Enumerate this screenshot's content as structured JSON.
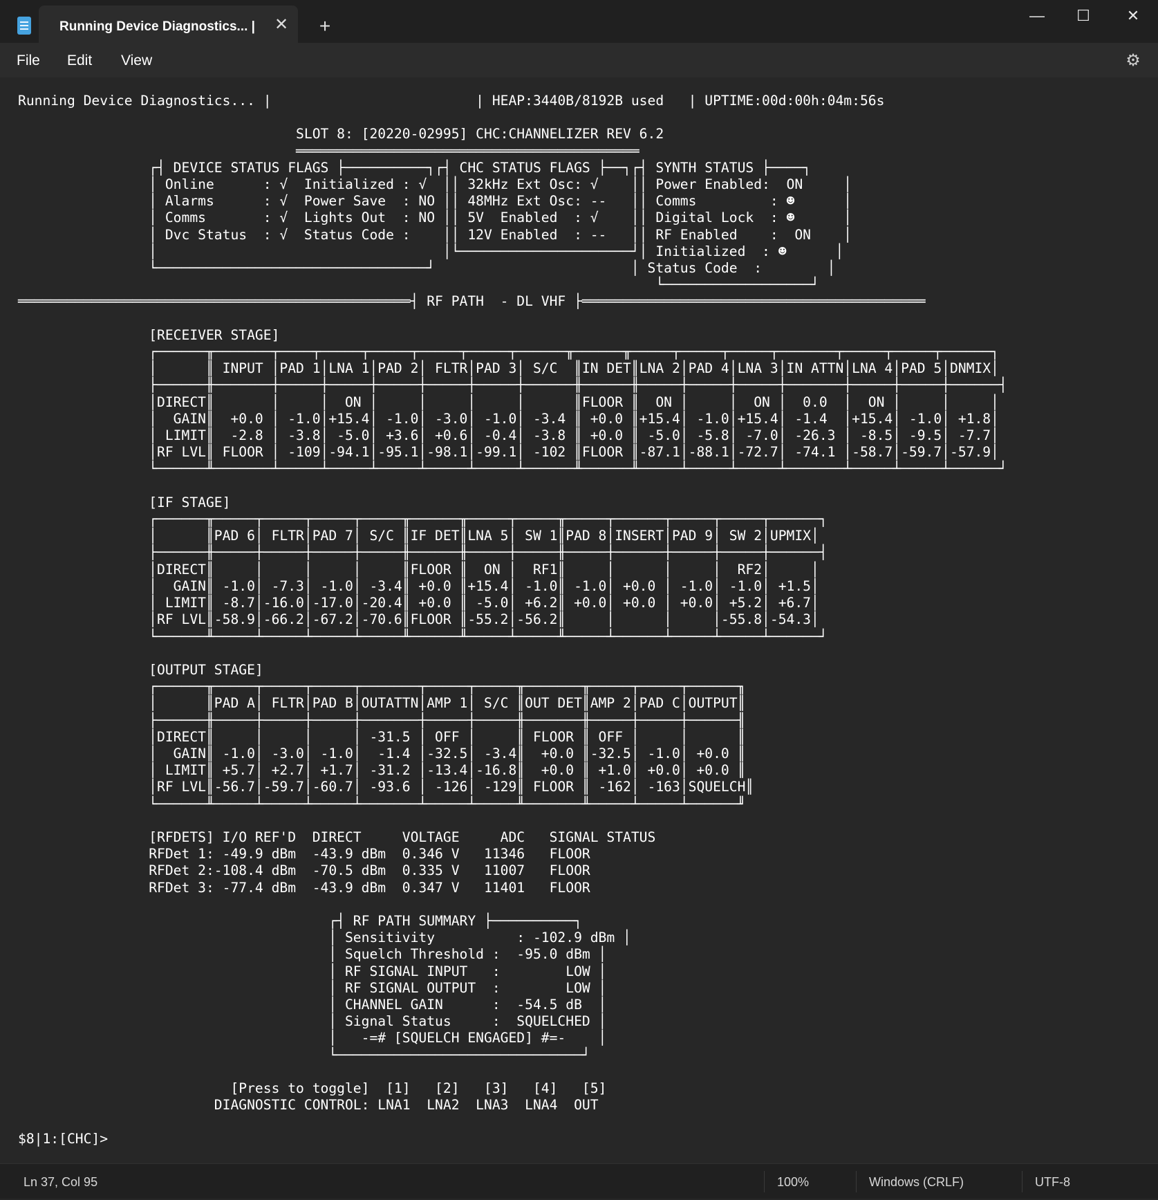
{
  "window": {
    "tab_title": "Running Device Diagnostics... |",
    "tab_close": "✕",
    "new_tab": "+",
    "minimize": "—",
    "maximize": "☐",
    "close": "✕"
  },
  "menu": {
    "file": "File",
    "edit": "Edit",
    "view": "View",
    "settings_icon": "gear-icon"
  },
  "document": {
    "lines": [
      "Running Device Diagnostics... |                         | HEAP:3440B/8192B used   | UPTIME:00d:00h:04m:56s",
      "",
      "                                  SLOT 8: [20220-02995] CHC:CHANNELIZER REV 6.2",
      "                                  ══════════════════════════════════════════",
      "                ┌┤ DEVICE STATUS FLAGS ├──────────┐┌┤ CHC STATUS FLAGS ├──┐┌┤ SYNTH STATUS ├────┐",
      "                │ Online      : √  Initialized : √  ││ 32kHz Ext Osc: √    ││ Power Enabled:  ON     │",
      "                │ Alarms      : √  Power Save  : NO ││ 48MHz Ext Osc: --   ││ Comms         : ☻      │",
      "                │ Comms       : √  Lights Out  : NO ││ 5V  Enabled  : √    ││ Digital Lock  : ☻      │",
      "                │ Dvc Status  : √  Status Code :    ││ 12V Enabled  : --   ││ RF Enabled    :  ON    │",
      "                │                                   │└─────────────────────┘│ Initialized  : ☻      │",
      "                └─────────────────────────────────┘                        │ Status Code  :        │",
      "                                                                              └──────────────────┘",
      "════════════════════════════════════════════════┤ RF PATH  - DL VHF ├══════════════════════════════════════════",
      "",
      "                [RECEIVER STAGE]",
      "                ┌──────╥───────┬────┬─────┬─────┬─────┬─────┬──────╥──────╥─────┬─────┬─────┬───────┬─────┬─────┬──────┐",
      "                │      ║ INPUT │PAD 1│LNA 1│PAD 2│ FLTR│PAD 3│ S/C  ║IN DET║LNA 2│PAD 4│LNA 3│IN ATTN│LNA 4│PAD 5│DNMIX│",
      "                ├──────╫───────┼─────┼─────┼─────┼─────┼─────┼──────╫──────╫─────┼─────┼─────┼───────┼─────┼─────┼──────┤",
      "                │DIRECT║       │     │  ON │     │     │     │      ║FLOOR ║  ON │     │  ON │  0.0  │  ON │     │     │",
      "                │  GAIN║  +0.0 │ -1.0│+15.4│ -1.0│ -3.0│ -1.0│ -3.4 ║ +0.0 ║+15.4│ -1.0│+15.4│ -1.4  │+15.4│ -1.0│ +1.8│",
      "                │ LIMIT║  -2.8 │ -3.8│ -5.0│ +3.6│ +0.6│ -0.4│ -3.8 ║ +0.0 ║ -5.0│ -5.8│ -7.0│ -26.3 │ -8.5│ -9.5│ -7.7│",
      "                │RF LVL║ FLOOR │ -109│-94.1│-95.1│-98.1│-99.1│ -102 ║FLOOR ║-87.1│-88.1│-72.7│ -74.1 │-58.7│-59.7│-57.9│",
      "                └──────╨───────┴─────┴─────┴─────┴─────┴─────┴──────╨──────╨─────┴─────┴─────┴───────┴─────┴─────┴──────┘",
      "",
      "                [IF STAGE]",
      "                ┌──────╥─────┬─────┬─────┬─────╥──────╥─────┬─────╥─────┬──────┬─────┬─────┬──────┐",
      "                │      ║PAD 6│ FLTR│PAD 7│ S/C ║IF DET║LNA 5│ SW 1║PAD 8│INSERT│PAD 9│ SW 2│UPMIX│",
      "                ├──────╫─────┼─────┼─────┼─────╫──────╫─────┼─────╫─────┼──────┼─────┼─────┼──────┤",
      "                │DIRECT║     │     │     │     ║FLOOR ║  ON │  RF1║     │      │     │  RF2│     │",
      "                │  GAIN║ -1.0│ -7.3│ -1.0│ -3.4║ +0.0 ║+15.4│ -1.0║ -1.0│ +0.0 │ -1.0│ -1.0│ +1.5│",
      "                │ LIMIT║ -8.7│-16.0│-17.0│-20.4║ +0.0 ║ -5.0│ +6.2║ +0.0│ +0.0 │ +0.0│ +5.2│ +6.7│",
      "                │RF LVL║-58.9│-66.2│-67.2│-70.6║FLOOR ║-55.2│-56.2║     │      │     │-55.8│-54.3│",
      "                └──────╨─────┴─────┴─────┴─────╨──────╨─────┴─────╨─────┴──────┴─────┴─────┴──────┘",
      "",
      "                [OUTPUT STAGE]",
      "                ┌──────╥─────┬─────┬─────┬───────┬─────┬─────╥───────╥─────┬─────┬──────╖",
      "                │      ║PAD A│ FLTR│PAD B│OUTATTN│AMP 1│ S/C ║OUT DET║AMP 2│PAD C│OUTPUT║",
      "                ├──────╫─────┼─────┼─────┼───────┼─────┼─────╫───────╫─────┼─────┼──────╢",
      "                │DIRECT║     │     │     │ -31.5 │ OFF │     ║ FLOOR ║ OFF │     │      ║",
      "                │  GAIN║ -1.0│ -3.0│ -1.0│  -1.4 │-32.5│ -3.4║  +0.0 ║-32.5│ -1.0│ +0.0 ║",
      "                │ LIMIT║ +5.7│ +2.7│ +1.7│ -31.2 │-13.4│-16.8║  +0.0 ║ +1.0│ +0.0│ +0.0 ║",
      "                │RF LVL║-56.7│-59.7│-60.7│ -93.6 │ -126│ -129║ FLOOR ║ -162│ -163│SQUELCH║",
      "                └──────╨─────┴─────┴─────┴───────┴─────┴─────╨───────╨─────┴─────┴──────╜",
      "",
      "                [RFDETS] I/O REF'D  DIRECT     VOLTAGE     ADC   SIGNAL STATUS",
      "                RFDet 1: -49.9 dBm  -43.9 dBm  0.346 V   11346   FLOOR",
      "                RFDet 2:-108.4 dBm  -70.5 dBm  0.335 V   11007   FLOOR",
      "                RFDet 3: -77.4 dBm  -43.9 dBm  0.347 V   11401   FLOOR",
      "",
      "                                      ┌┤ RF PATH SUMMARY ├──────────┐",
      "                                      │ Sensitivity          : -102.9 dBm │",
      "                                      │ Squelch Threshold :  -95.0 dBm │",
      "                                      │ RF SIGNAL INPUT   :        LOW │",
      "                                      │ RF SIGNAL OUTPUT  :        LOW │",
      "                                      │ CHANNEL GAIN      :  -54.5 dB  │",
      "                                      │ Signal Status     :  SQUELCHED │",
      "                                      │   -=# [SQUELCH ENGAGED] #=-    │",
      "                                      └──────────────────────────────┘",
      "",
      "                          [Press to toggle]  [1]   [2]   [3]   [4]   [5]",
      "                        DIAGNOSTIC CONTROL: LNA1  LNA2  LNA3  LNA4  OUT",
      "",
      "$8|1:[CHC]>"
    ]
  },
  "status": {
    "position": "Ln 37, Col 95",
    "zoom": "100%",
    "line_ending": "Windows (CRLF)",
    "encoding": "UTF-8"
  }
}
